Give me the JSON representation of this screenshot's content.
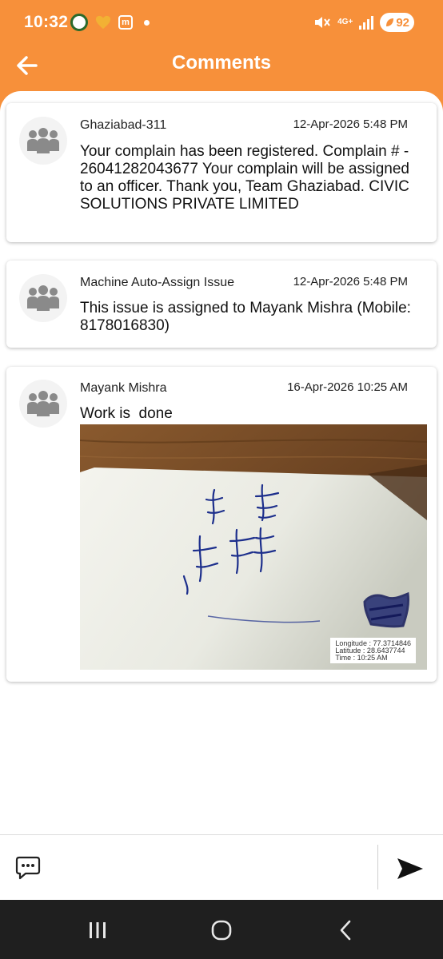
{
  "status_bar": {
    "time": "10:32",
    "app_badge": "m",
    "network": "4G+",
    "battery": "92"
  },
  "header": {
    "title": "Comments",
    "back_icon": "arrow-left-icon"
  },
  "comments": [
    {
      "author": "Ghaziabad-311",
      "date": "12-Apr-2026 5:48 PM",
      "text": "Your complain has been registered. Complain # - 26041282043677 Your complain will be assigned to an officer. Thank you, Team Ghaziabad. CIVIC SOLUTIONS PRIVATE LIMITED"
    },
    {
      "author": "Machine Auto-Assign Issue",
      "date": "12-Apr-2026 5:48 PM",
      "text": "This issue is assigned to Mayank Mishra (Mobile: 8178016830)"
    },
    {
      "author": "Mayank Mishra",
      "date": "16-Apr-2026 10:25 AM",
      "text": "Work is  done",
      "photo": {
        "stamp_longitude": "Longitude : 77.3714846",
        "stamp_latitude": "Latitude : 28.6437744",
        "stamp_time": "Time : 10:25 AM"
      }
    }
  ],
  "composer": {
    "placeholder": "",
    "chat_icon": "chat-bubble-icon",
    "send_icon": "send-icon"
  },
  "nav": {
    "recents_icon": "recents-icon",
    "home_icon": "home-icon",
    "back_icon": "nav-back-icon"
  },
  "colors": {
    "accent": "#f7903a",
    "nav_bar": "#1f1f1f"
  }
}
